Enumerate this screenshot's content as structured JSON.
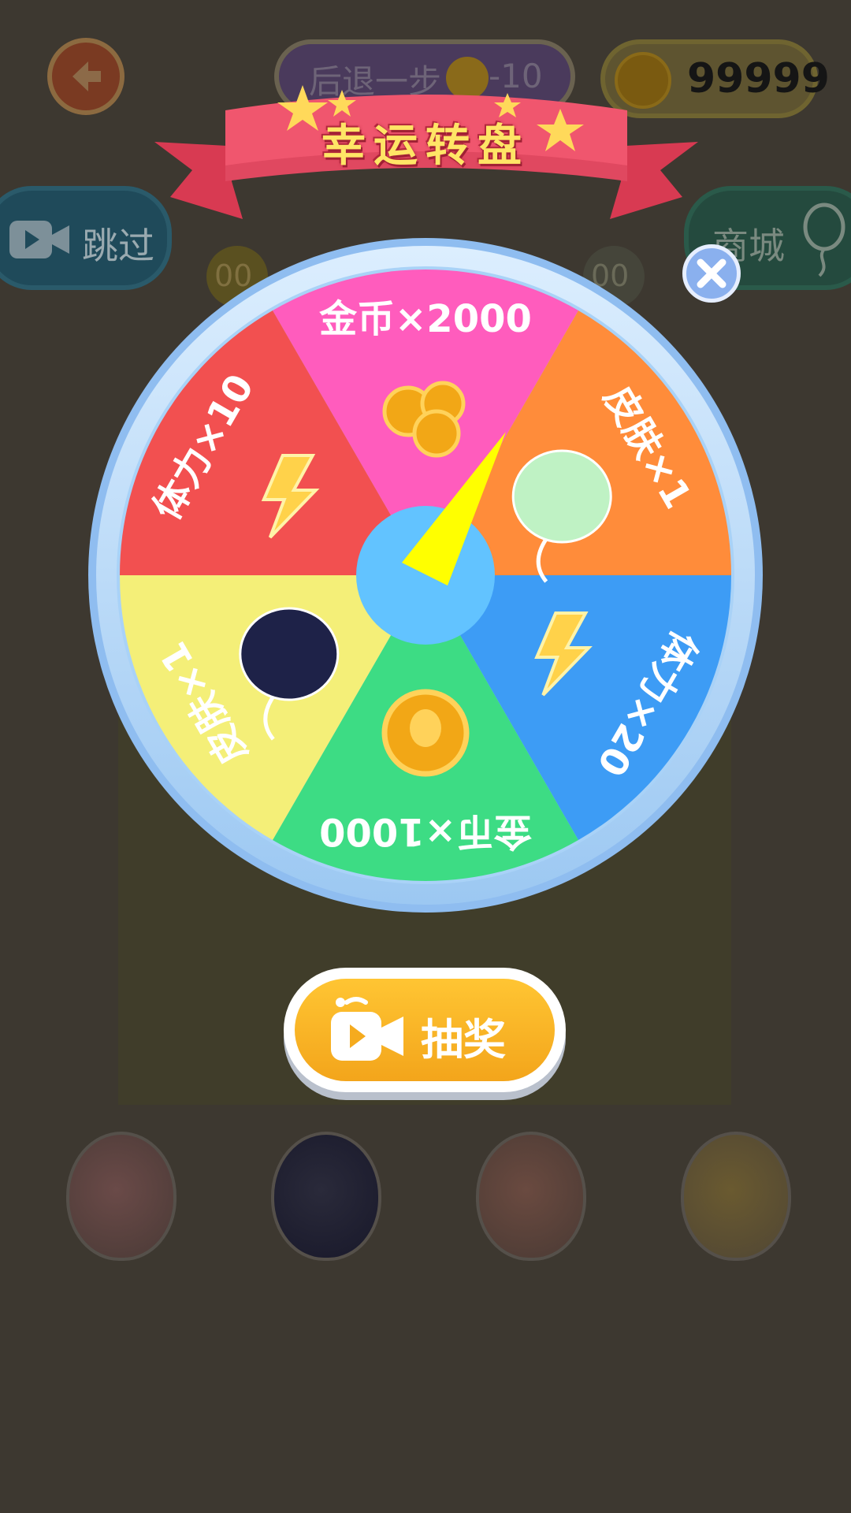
{
  "header": {
    "undo_label": "后退一步",
    "undo_cost": "-10",
    "coin_balance": "99999"
  },
  "side_buttons": {
    "skip_label": "跳过",
    "shop_label": "商城"
  },
  "background_counters": [
    "00",
    "00"
  ],
  "popup": {
    "title": "幸运转盘",
    "draw_button_label": "抽奖"
  },
  "wheel": {
    "segments": [
      {
        "label": "金币×2000",
        "color": "#ff5cbd",
        "reward_icon": "coins-icon"
      },
      {
        "label": "皮肤×1",
        "color": "#ff8c3a",
        "reward_icon": "balloon-skin-icon"
      },
      {
        "label": "体力×20",
        "color": "#3d9cf5",
        "reward_icon": "lightning-icon"
      },
      {
        "label": "金币×1000",
        "color": "#3ddc84",
        "reward_icon": "coin-icon"
      },
      {
        "label": "皮肤×1",
        "color": "#f4ef78",
        "reward_icon": "balloon-skin-icon"
      },
      {
        "label": "体力×10",
        "color": "#f25050",
        "reward_icon": "lightning-icon"
      }
    ],
    "hub_color": "#62c3ff",
    "pointer_color": "#ffff00",
    "rim_color": "#cfe7fb"
  },
  "colors": {
    "ribbon": "#f0566e",
    "title_text": "#ffe566",
    "draw_button": "#f7b321"
  }
}
